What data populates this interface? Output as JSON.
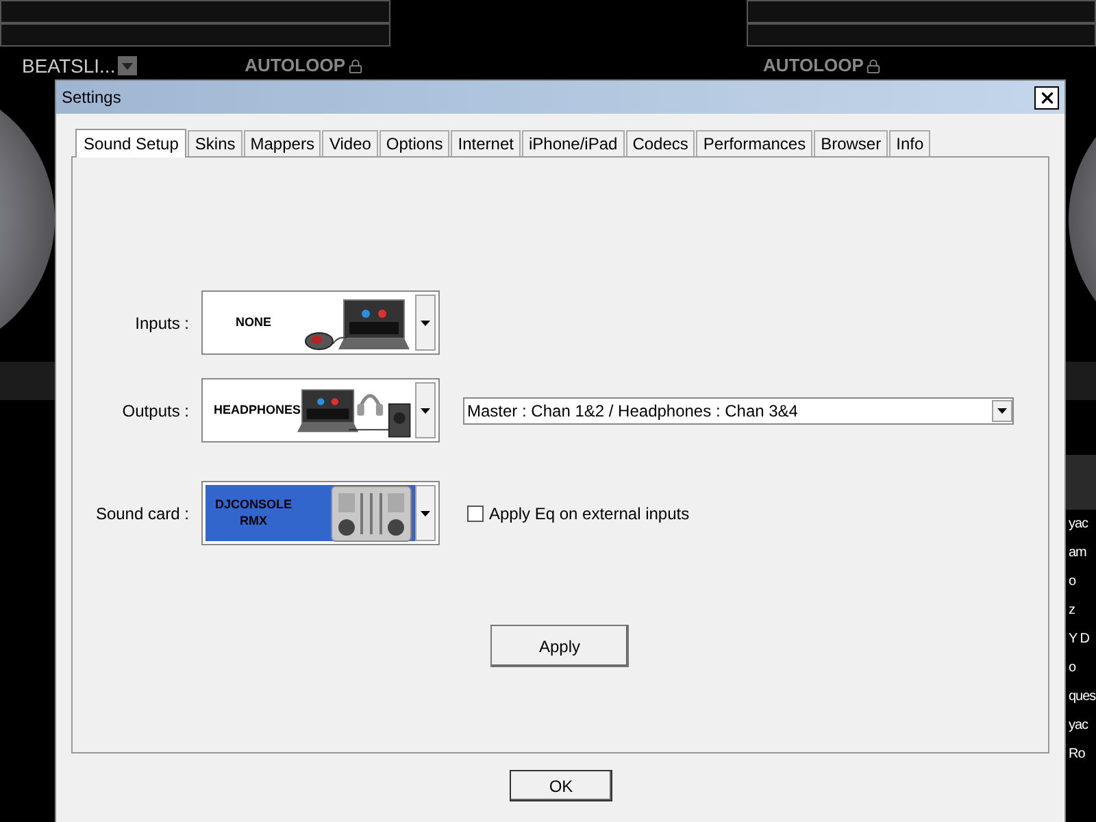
{
  "background": {
    "left_deck": {
      "effect": "BEATSLI...",
      "autoloop": "AUTOLOOP"
    },
    "right_deck": {
      "autoloop": "AUTOLOOP"
    },
    "browser_rows": [
      "yac",
      "am",
      "o",
      "z",
      "Y D",
      "o",
      "ques",
      "yac",
      "Ro"
    ]
  },
  "dialog": {
    "title": "Settings",
    "tabs": [
      {
        "label": "Sound Setup",
        "selected": true
      },
      {
        "label": "Skins",
        "selected": false
      },
      {
        "label": "Mappers",
        "selected": false
      },
      {
        "label": "Video",
        "selected": false
      },
      {
        "label": "Options",
        "selected": false
      },
      {
        "label": "Internet",
        "selected": false
      },
      {
        "label": "iPhone/iPad",
        "selected": false
      },
      {
        "label": "Codecs",
        "selected": false
      },
      {
        "label": "Performances",
        "selected": false
      },
      {
        "label": "Browser",
        "selected": false
      },
      {
        "label": "Info",
        "selected": false
      }
    ],
    "devices": [
      {
        "label": "Inputs :",
        "value": "NONE",
        "kind": "mouse",
        "highlighted": false
      },
      {
        "label": "Outputs :",
        "value": "HEADPHONES",
        "kind": "headphones",
        "highlighted": false
      },
      {
        "label": "Sound card :",
        "value": "DJCONSOLE RMX",
        "kind": "console",
        "highlighted": true
      }
    ],
    "routing": "Master : Chan 1&2 / Headphones : Chan 3&4",
    "eq_checkbox": {
      "label": "Apply Eq on external inputs",
      "checked": false
    },
    "apply": "Apply",
    "ok": "OK"
  }
}
